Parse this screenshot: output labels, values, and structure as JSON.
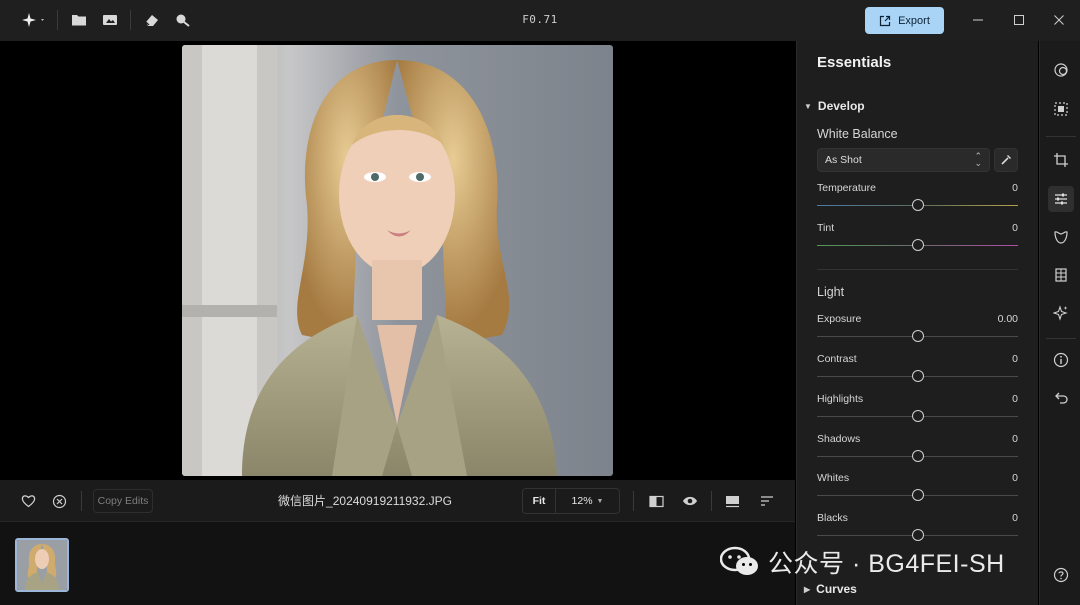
{
  "window": {
    "title": "F0.71"
  },
  "toolbar": {
    "export_label": "Export"
  },
  "bottom": {
    "copy_edits_label": "Copy Edits",
    "filename": "微信图片_20240919211932.JPG",
    "fit_label": "Fit",
    "zoom_label": "12%"
  },
  "panel": {
    "title": "Essentials",
    "develop_label": "Develop",
    "white_balance_label": "White Balance",
    "wb_preset": "As Shot",
    "light_label": "Light",
    "curves_label": "Curves",
    "sliders": [
      {
        "label": "Temperature",
        "value": "0",
        "level": 0.5
      },
      {
        "label": "Tint",
        "value": "0",
        "level": 0.5
      },
      {
        "label": "Exposure",
        "value": "0.00",
        "level": 0.5
      },
      {
        "label": "Contrast",
        "value": "0",
        "level": 0.5
      },
      {
        "label": "Highlights",
        "value": "0",
        "level": 0.5
      },
      {
        "label": "Shadows",
        "value": "0",
        "level": 0.5
      },
      {
        "label": "Whites",
        "value": "0",
        "level": 0.5
      },
      {
        "label": "Blacks",
        "value": "0",
        "level": 0.5
      }
    ]
  },
  "watermark": {
    "text": "公众号 · BG4FEI-SH"
  },
  "colors": {
    "accent": "#a9d4f5",
    "panel_bg": "#1e1e1e",
    "topbar_bg": "#1f1f1f"
  }
}
